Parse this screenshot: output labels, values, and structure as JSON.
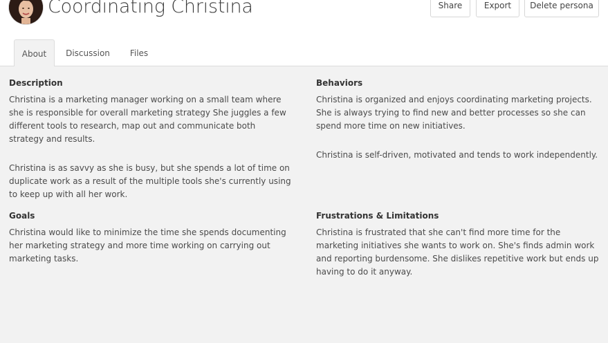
{
  "persona": {
    "name": "Coordinating Christina"
  },
  "header": {
    "share_label": "Share",
    "export_label": "Export",
    "delete_label": "Delete persona"
  },
  "tabs": [
    {
      "label": "About",
      "active": true
    },
    {
      "label": "Discussion",
      "active": false
    },
    {
      "label": "Files",
      "active": false
    }
  ],
  "sections": {
    "description": {
      "title": "Description",
      "paragraphs": [
        "Christina is a marketing manager working on a small team where she is responsible for overall marketing strategy She juggles a few different tools to research, map out and communicate both strategy and results.",
        "Christina is as savvy as she is busy, but she spends a lot of time on duplicate work as a result of the multiple tools she's currently using to keep up with all her work."
      ]
    },
    "behaviors": {
      "title": "Behaviors",
      "paragraphs": [
        "Christina is organized and enjoys coordinating marketing projects. She is always trying to find new and better processes so she can spend more time on new initiatives.",
        "Christina is self-driven, motivated and tends to work independently."
      ]
    },
    "goals": {
      "title": "Goals",
      "paragraphs": [
        "Christina would like to minimize the time she spends documenting her marketing strategy and more time working on carrying out marketing tasks."
      ]
    },
    "frustrations": {
      "title": "Frustrations & Limitations",
      "paragraphs": [
        "Christina is frustrated that she can't find more time for the marketing initiatives she wants to work on. She's finds admin work and reporting burdensome. She dislikes repetitive work but ends up having to do it anyway."
      ]
    }
  },
  "colors": {
    "content_background": "#f2f2f2",
    "border": "#dcdcdc",
    "title_text": "#3a3a3a"
  }
}
